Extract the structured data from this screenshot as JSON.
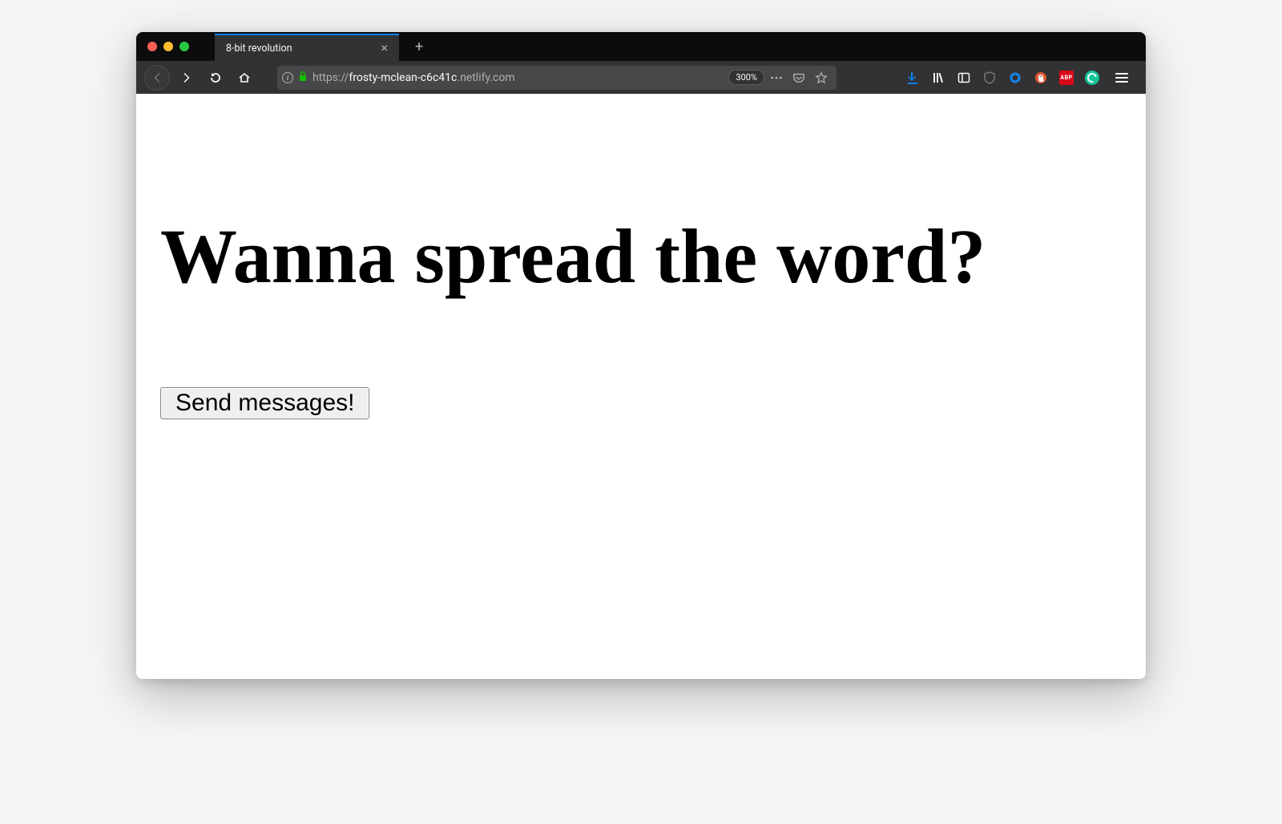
{
  "tab": {
    "title": "8-bit revolution"
  },
  "toolbar": {
    "url_protocol": "https://",
    "url_host": "frosty-mclean-c6c41c",
    "url_domain_tail": ".netlify.com",
    "zoom_label": "300%"
  },
  "page": {
    "heading": "Wanna spread the word?",
    "button_label": "Send messages!"
  },
  "extensions": {
    "abp_label": "ABP"
  }
}
